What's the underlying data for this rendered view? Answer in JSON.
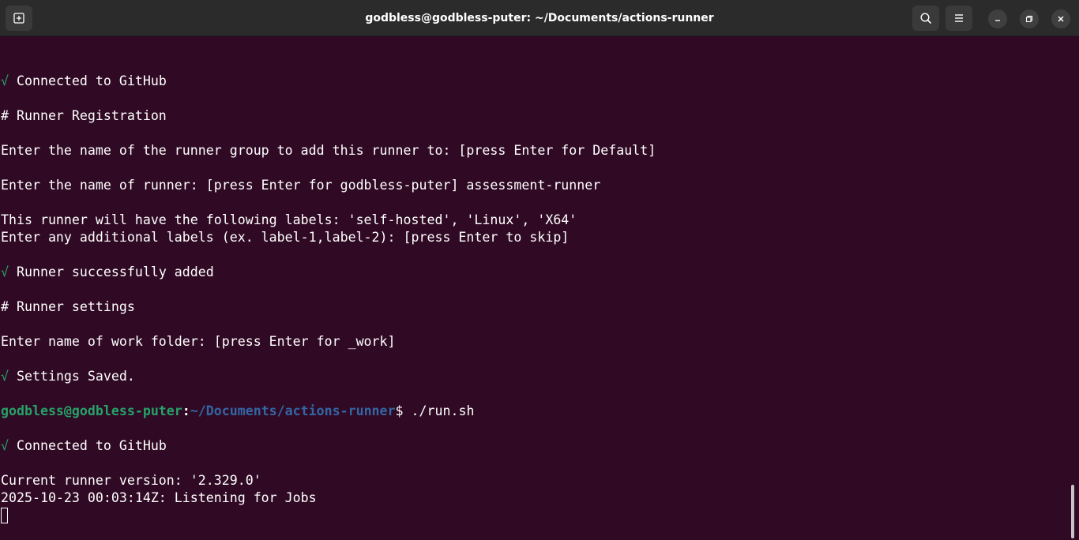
{
  "window": {
    "title": "godbless@godbless-puter: ~/Documents/actions-runner"
  },
  "icons": {
    "new_tab": "new-tab-icon",
    "search": "search-icon",
    "menu": "hamburger-menu-icon",
    "minimize": "minimize-icon",
    "maximize": "maximize-icon",
    "close": "close-icon"
  },
  "colors": {
    "background": "#300a24",
    "titlebar": "#2b2b2b",
    "check": "#26a269",
    "prompt_user": "#26a269",
    "prompt_path": "#3465a4"
  },
  "terminal": {
    "check_mark": "√",
    "lines": {
      "l1": " Connected to GitHub",
      "l2": "# Runner Registration",
      "l3": "Enter the name of the runner group to add this runner to: [press Enter for Default]",
      "l4": "Enter the name of runner: [press Enter for godbless-puter] assessment-runner",
      "l5": "This runner will have the following labels: 'self-hosted', 'Linux', 'X64'",
      "l6": "Enter any additional labels (ex. label-1,label-2): [press Enter to skip]",
      "l7": " Runner successfully added",
      "l8": "# Runner settings",
      "l9": "Enter name of work folder: [press Enter for _work]",
      "l10": " Settings Saved.",
      "l12": " Connected to GitHub",
      "l13": "Current runner version: '2.329.0'",
      "l14": "2025-10-23 00:03:14Z: Listening for Jobs"
    },
    "prompt": {
      "user_host": "godbless@godbless-puter",
      "colon": ":",
      "path": "~/Documents/actions-runner",
      "symbol": "$",
      "command": " ./run.sh"
    }
  }
}
